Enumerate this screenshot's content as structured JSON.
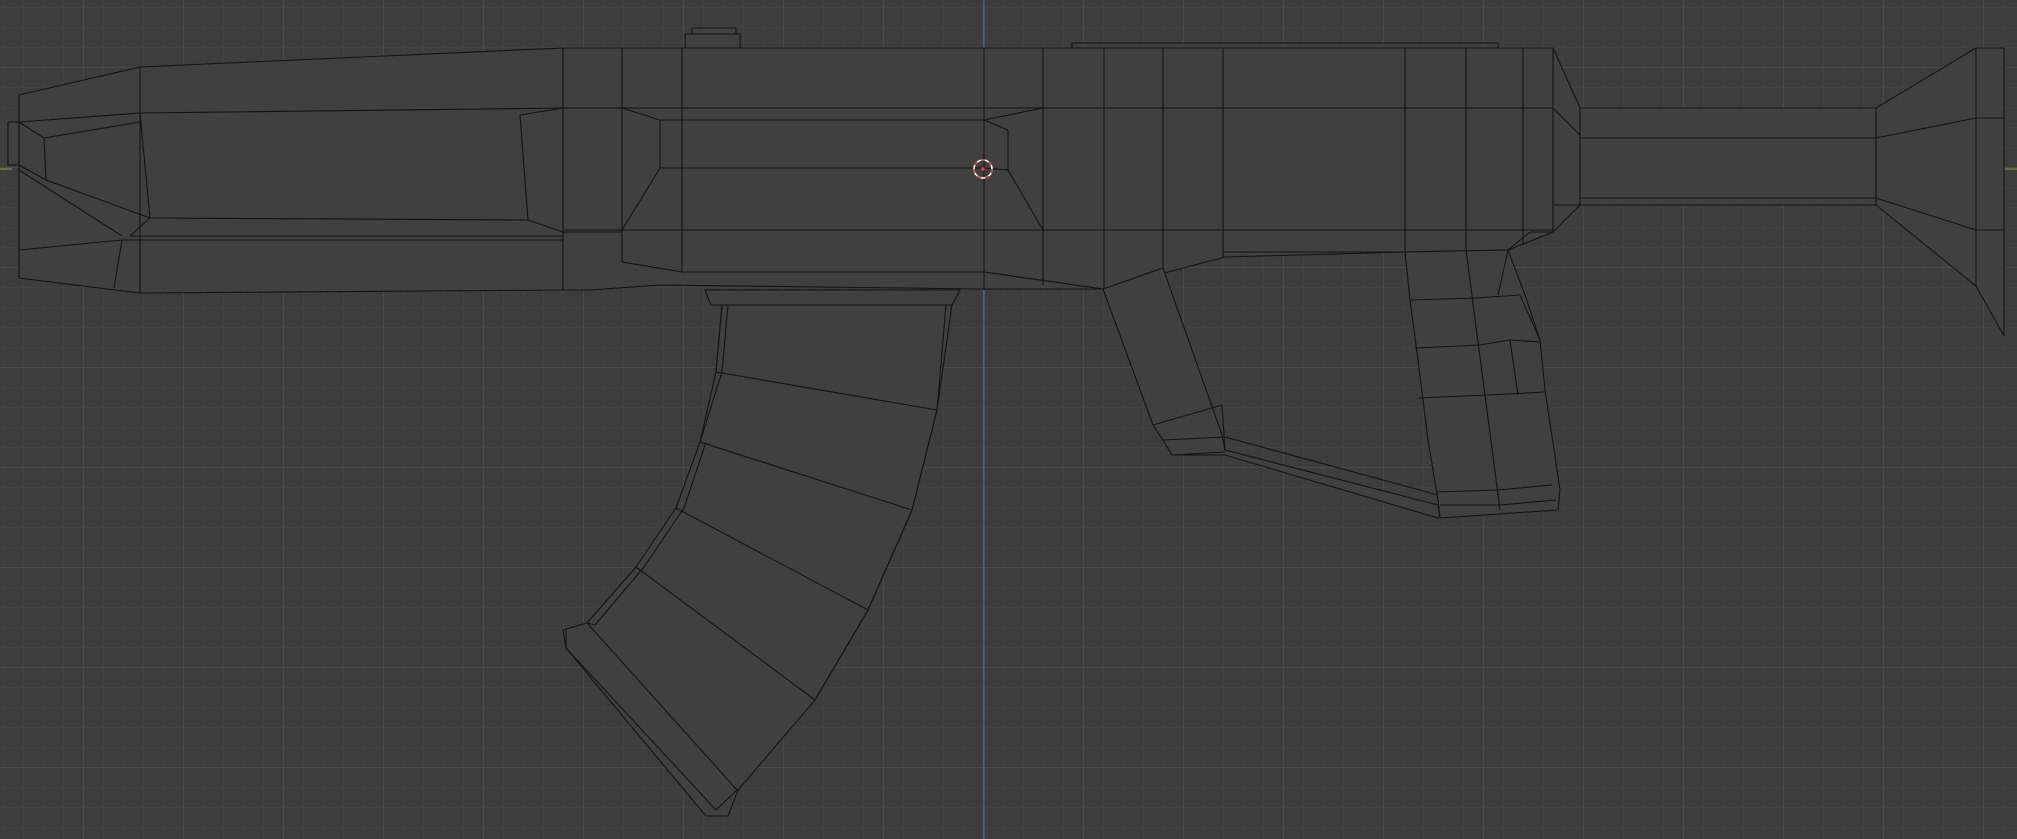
{
  "viewport": {
    "view_mode": "orthographic-side",
    "shading": "wireframe-over-solid",
    "colors": {
      "background": "#3d3d3d",
      "grid_minor": "#454545",
      "grid_major": "#4f4f4f",
      "axis_vertical": "#3f6ca8",
      "axis_horizontal": "#8a8f3a",
      "mesh_fill": "#404040",
      "mesh_edge": "#141414",
      "cursor_ring": "#ffffff",
      "cursor_dash": "#e04040"
    },
    "objects": [
      {
        "name": "rifle-mesh",
        "parts": [
          "stock",
          "receiver",
          "handguard",
          "magazine",
          "trigger-guard",
          "pistol-grip",
          "muzzle"
        ]
      }
    ],
    "cursor_icon": "3d-cursor-icon"
  }
}
